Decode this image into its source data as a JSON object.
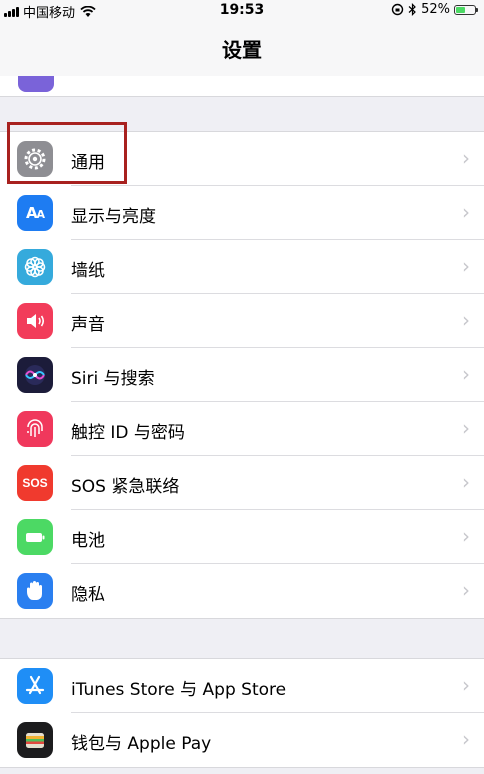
{
  "status_bar": {
    "carrier": "中国移动",
    "time": "19:53",
    "battery_percent": "52%",
    "battery_level": 0.52,
    "icons": [
      "signal-icon",
      "wifi-icon",
      "rotation-lock-icon",
      "bluetooth-icon",
      "battery-icon"
    ]
  },
  "nav": {
    "title": "设置"
  },
  "groups": [
    {
      "items": [
        {
          "label": "通用",
          "icon": "gear-icon",
          "color": "#8e8e93"
        },
        {
          "label": "显示与亮度",
          "icon": "display-icon",
          "color": "#1e7cf2"
        },
        {
          "label": "墙纸",
          "icon": "wallpaper-flower-icon",
          "color": "#35aadc"
        },
        {
          "label": "声音",
          "icon": "speaker-icon",
          "color": "#f23c5a"
        },
        {
          "label": "Siri 与搜索",
          "icon": "siri-icon",
          "color": "#1c1c3a"
        },
        {
          "label": "触控 ID 与密码",
          "icon": "fingerprint-icon",
          "color": "#f0385c"
        },
        {
          "label": "SOS 紧急联络",
          "icon": "sos-icon",
          "color": "#f03a2e",
          "icon_text": "SOS"
        },
        {
          "label": "电池",
          "icon": "battery-app-icon",
          "color": "#4cd964"
        },
        {
          "label": "隐私",
          "icon": "hand-icon",
          "color": "#2a7ff0"
        }
      ]
    },
    {
      "items": [
        {
          "label": "iTunes Store 与 App Store",
          "icon": "app-store-icon",
          "color": "#1f8ef6"
        },
        {
          "label": "钱包与 Apple Pay",
          "icon": "wallet-icon",
          "color": "#1c1c1e"
        }
      ]
    }
  ],
  "colors": {
    "background": "#efeff4",
    "highlight": "#a8211f",
    "chevron": "#c7c7cc"
  }
}
